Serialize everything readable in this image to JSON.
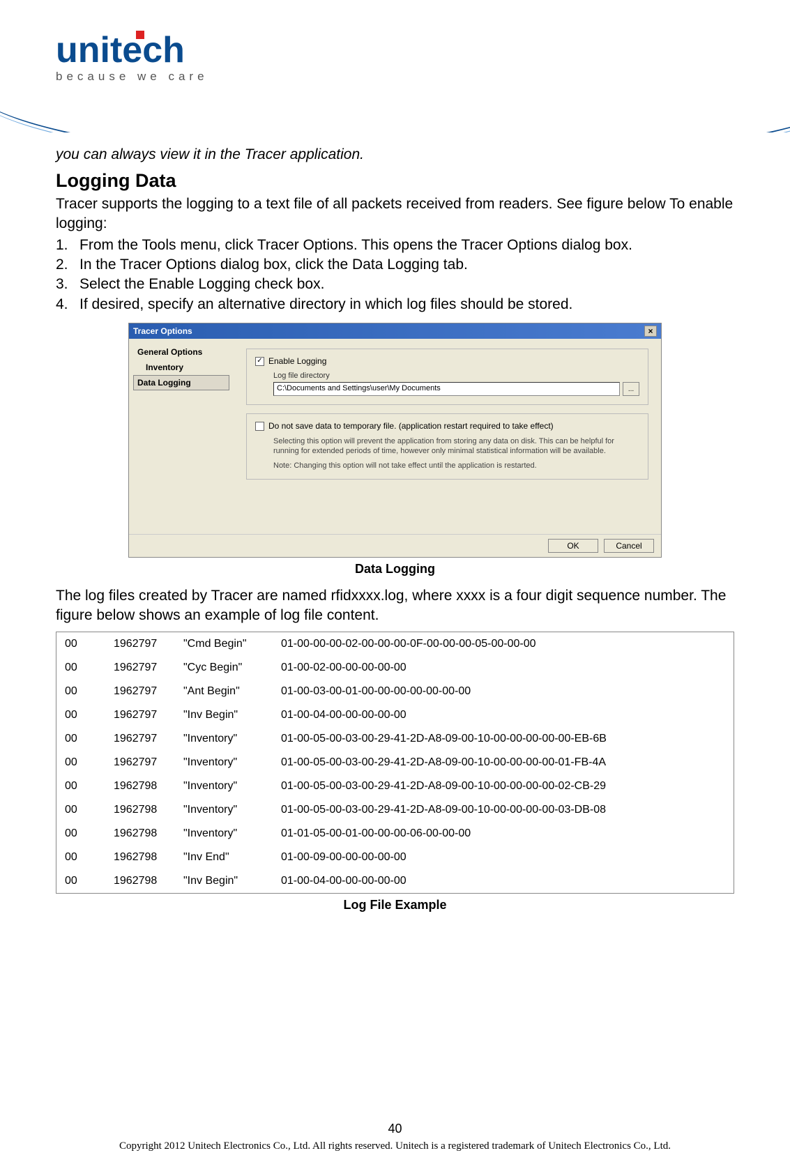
{
  "header": {
    "logo_main": "unitech",
    "logo_sub": "because we care"
  },
  "lead": "you can always view it in the Tracer application.",
  "section_title": "Logging Data",
  "intro": "Tracer supports the logging to a text file of all packets received from readers. See figure below To enable logging:",
  "steps": [
    "From the Tools menu, click Tracer Options. This opens the Tracer Options dialog box.",
    "In the Tracer Options dialog box, click the Data Logging tab.",
    "Select the Enable Logging check box.",
    "If desired, specify an alternative directory in which log files should be stored."
  ],
  "dialog": {
    "title": "Tracer Options",
    "close_glyph": "×",
    "side_items": [
      {
        "label": "General Options",
        "bold": true,
        "selected": false,
        "indent": false
      },
      {
        "label": "Inventory",
        "bold": true,
        "selected": false,
        "indent": true
      },
      {
        "label": "Data Logging",
        "bold": true,
        "selected": true,
        "indent": true
      }
    ],
    "enable_checkbox_label": "Enable Logging",
    "enable_checked_glyph": "✓",
    "log_dir_label": "Log file directory",
    "log_dir_value": "C:\\Documents and Settings\\user\\My Documents",
    "browse_label": "...",
    "temp_checkbox_label": "Do not save data to temporary file. (application restart required to take effect)",
    "temp_note1": "Selecting this option will prevent the application from storing any data on disk. This can be helpful for running for extended periods of time, however only minimal statistical information will be available.",
    "temp_note2": "Note: Changing this option will not take effect until the application is restarted.",
    "ok_label": "OK",
    "cancel_label": "Cancel"
  },
  "caption1": "Data Logging",
  "mid_text": "The log files created by Tracer are named rfidxxxx.log, where xxxx is a four digit sequence number. The figure below shows an example of log file content.",
  "log_rows": [
    {
      "a": "00",
      "b": "1962797",
      "c": "\"Cmd Begin\"",
      "d": "01-00-00-00-02-00-00-00-0F-00-00-00-05-00-00-00"
    },
    {
      "a": "00",
      "b": "1962797",
      "c": "\"Cyc Begin\"",
      "d": "01-00-02-00-00-00-00-00"
    },
    {
      "a": "00",
      "b": "1962797",
      "c": "\"Ant Begin\"",
      "d": "01-00-03-00-01-00-00-00-00-00-00-00"
    },
    {
      "a": "00",
      "b": "1962797",
      "c": "\"Inv Begin\"",
      "d": "01-00-04-00-00-00-00-00"
    },
    {
      "a": "00",
      "b": "1962797",
      "c": "\"Inventory\"",
      "d": "01-00-05-00-03-00-29-41-2D-A8-09-00-10-00-00-00-00-00-EB-6B"
    },
    {
      "a": "00",
      "b": "1962797",
      "c": "\"Inventory\"",
      "d": "01-00-05-00-03-00-29-41-2D-A8-09-00-10-00-00-00-00-01-FB-4A"
    },
    {
      "a": "00",
      "b": "1962798",
      "c": "\"Inventory\"",
      "d": "01-00-05-00-03-00-29-41-2D-A8-09-00-10-00-00-00-00-02-CB-29"
    },
    {
      "a": "00",
      "b": "1962798",
      "c": "\"Inventory\"",
      "d": "01-00-05-00-03-00-29-41-2D-A8-09-00-10-00-00-00-00-03-DB-08"
    },
    {
      "a": "00",
      "b": "1962798",
      "c": "\"Inventory\"",
      "d": "01-01-05-00-01-00-00-00-06-00-00-00"
    },
    {
      "a": "00",
      "b": "1962798",
      "c": "\"Inv End\"",
      "d": "01-00-09-00-00-00-00-00"
    },
    {
      "a": "00",
      "b": "1962798",
      "c": "\"Inv Begin\"",
      "d": "01-00-04-00-00-00-00-00"
    }
  ],
  "caption2": "Log File Example",
  "page_number": "40",
  "copyright": "Copyright 2012 Unitech Electronics Co., Ltd. All rights reserved. Unitech is a registered trademark of Unitech Electronics Co., Ltd."
}
